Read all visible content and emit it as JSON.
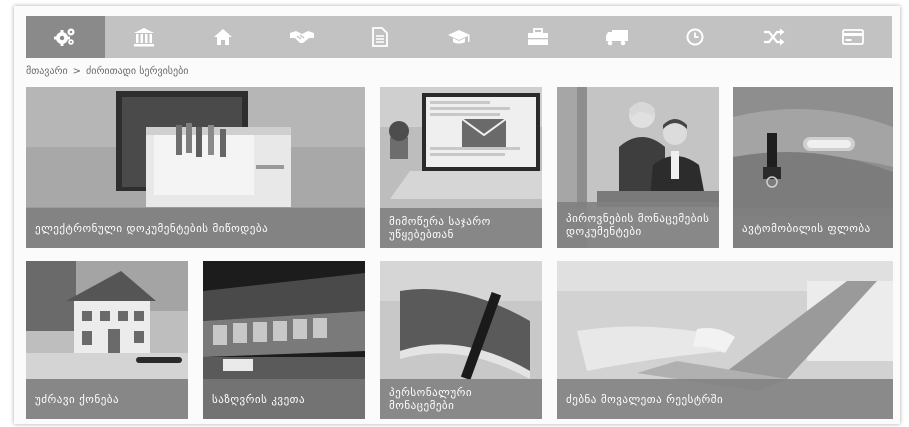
{
  "nav": {
    "items": [
      {
        "icon": "gears-icon",
        "active": true
      },
      {
        "icon": "bank-icon",
        "active": false
      },
      {
        "icon": "home-icon",
        "active": false
      },
      {
        "icon": "handshake-icon",
        "active": false
      },
      {
        "icon": "document-icon",
        "active": false
      },
      {
        "icon": "graduation-cap-icon",
        "active": false
      },
      {
        "icon": "briefcase-icon",
        "active": false
      },
      {
        "icon": "truck-icon",
        "active": false
      },
      {
        "icon": "clock-icon",
        "active": false
      },
      {
        "icon": "shuffle-icon",
        "active": false
      },
      {
        "icon": "credit-card-icon",
        "active": false
      }
    ]
  },
  "breadcrumb": {
    "home": "მთავარი",
    "separator": ">",
    "current": "ძირითადი სერვისები"
  },
  "tiles": [
    {
      "label": "ელექტრონული დოკუმენტების მიწოდება"
    },
    {
      "label": "მიმოწერა საჯარო უწყებებთან"
    },
    {
      "label": "პიროვნების მონაცემების დოკუმენტები"
    },
    {
      "label": "ავტომობილის ფლობა"
    },
    {
      "label": "უძრავი ქონება"
    },
    {
      "label": "საზღვრის კვეთა"
    },
    {
      "label": "პერსონალური მონაცემები"
    },
    {
      "label": "ძებნა მოვალეთა რეესტრში"
    }
  ],
  "colors": {
    "nav_bg": "#c2c2c2",
    "nav_active": "#8a8a8a",
    "caption_bg": "#808080",
    "text": "#ffffff"
  }
}
